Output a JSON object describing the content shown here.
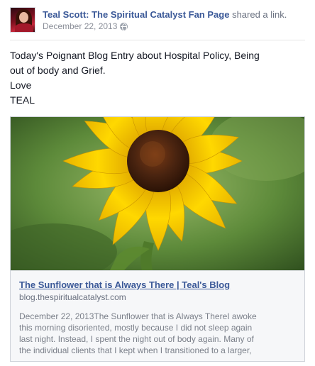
{
  "post": {
    "author": "Teal Scott: The Spiritual Catalyst Fan Page",
    "action": "shared a link.",
    "date": "December 22, 2013",
    "privacy_icon": "globe-icon",
    "message_lines": [
      "Today's Poignant Blog Entry about Hospital Policy, Being",
      "out of body and Grief.",
      "Love",
      "TEAL"
    ]
  },
  "link": {
    "image_subject": "sunflower",
    "title": "The Sunflower that is Always There | Teal's Blog",
    "domain": "blog.thespiritualcatalyst.com",
    "description_lines": [
      "December 22, 2013The Sunflower that is Always ThereI awoke",
      "this morning disoriented, mostly because I did not sleep again",
      "last night. Instead, I spent the night out of body again. Many of",
      "the individual clients that I kept when I transitioned to a larger,"
    ]
  },
  "colors": {
    "link_blue": "#3b5998",
    "meta_grey": "#8b8f99",
    "text": "#141823",
    "petal_yellow": "#f5c800",
    "center_brown": "#4a2410",
    "background_green": "#5d8a3a"
  }
}
